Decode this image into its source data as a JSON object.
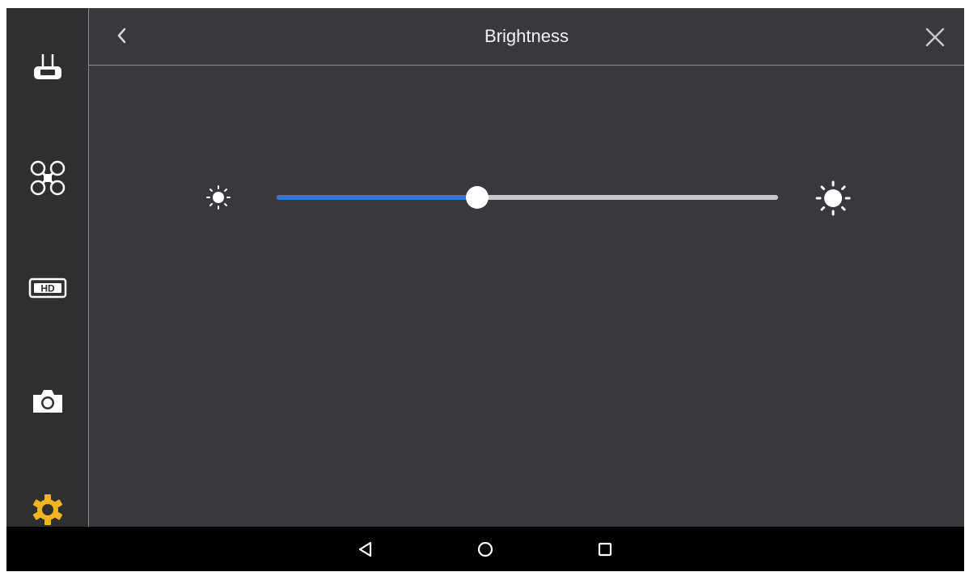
{
  "header": {
    "title": "Brightness",
    "back_icon": "chevron-left-icon",
    "close_icon": "close-icon"
  },
  "sidebar": {
    "items": [
      {
        "name": "remote-controller",
        "icon": "remote-controller-icon",
        "active": false
      },
      {
        "name": "aircraft",
        "icon": "drone-icon",
        "active": false
      },
      {
        "name": "hd-transmission",
        "icon": "hd-icon",
        "active": false
      },
      {
        "name": "camera",
        "icon": "camera-icon",
        "active": false
      },
      {
        "name": "settings",
        "icon": "gear-icon",
        "active": true
      }
    ]
  },
  "brightness": {
    "level_percent": 40,
    "min_icon": "sun-small-icon",
    "max_icon": "sun-large-icon"
  },
  "navbar": {
    "buttons": [
      "back-triangle-icon",
      "home-circle-icon",
      "recents-square-icon"
    ]
  },
  "colors": {
    "background": "#3a383c",
    "sidebar": "#2f2e31",
    "accent_blue": "#2f78d6",
    "active_gold": "#f0b41e",
    "track": "#c9c8cc"
  }
}
